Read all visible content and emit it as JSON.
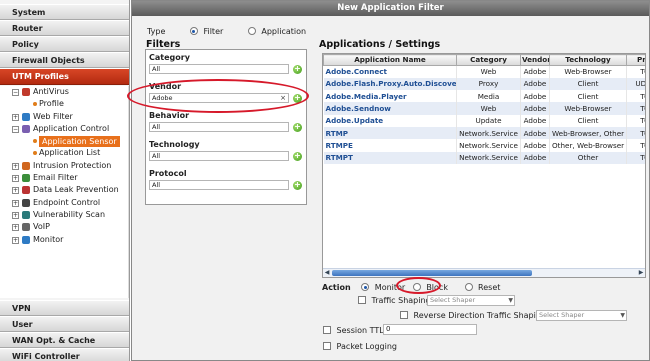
{
  "nav": {
    "top_sections": [
      "System",
      "Router",
      "Policy",
      "Firewall Objects",
      "UTM Profiles"
    ],
    "active_section": "UTM Profiles",
    "tree": [
      {
        "label": "AntiVirus",
        "level": 0,
        "expander": "−",
        "icon_color": "#c0392b",
        "icon": "shield-icon"
      },
      {
        "label": "Profile",
        "level": 1,
        "icon": "bullet-icon"
      },
      {
        "label": "Web Filter",
        "level": 0,
        "expander": "+",
        "icon_color": "#2e7bc4",
        "icon": "globe-icon"
      },
      {
        "label": "Application Control",
        "level": 0,
        "expander": "−",
        "icon_color": "#7a5fb0",
        "icon": "app-control-icon"
      },
      {
        "label": "Application Sensor",
        "level": 1,
        "selected": true,
        "icon": "bullet-icon"
      },
      {
        "label": "Application List",
        "level": 1,
        "icon": "bullet-icon"
      },
      {
        "label": "Intrusion Protection",
        "level": 0,
        "expander": "+",
        "icon_color": "#d0661e",
        "icon": "shield-icon"
      },
      {
        "label": "Email Filter",
        "level": 0,
        "expander": "+",
        "icon_color": "#3b8e3b",
        "icon": "mail-icon"
      },
      {
        "label": "Data Leak Prevention",
        "level": 0,
        "expander": "+",
        "icon_color": "#b33",
        "icon": "lock-icon"
      },
      {
        "label": "Endpoint Control",
        "level": 0,
        "expander": "+",
        "icon_color": "#444",
        "icon": "computer-icon"
      },
      {
        "label": "Vulnerability Scan",
        "level": 0,
        "expander": "+",
        "icon_color": "#2a7a7a",
        "icon": "scan-icon"
      },
      {
        "label": "VoIP",
        "level": 0,
        "expander": "+",
        "icon_color": "#666",
        "icon": "phone-icon"
      },
      {
        "label": "Monitor",
        "level": 0,
        "expander": "+",
        "icon_color": "#2e7bc4",
        "icon": "monitor-icon"
      }
    ],
    "bottom_sections": [
      "VPN",
      "User",
      "WAN Opt. & Cache",
      "WiFi Controller"
    ]
  },
  "dialog": {
    "title": "New Application Filter",
    "type_label": "Type",
    "type_options": [
      "Filter",
      "Application"
    ],
    "type_selected": "Filter",
    "filters_title": "Filters",
    "filters": [
      {
        "label": "Category",
        "value": "All"
      },
      {
        "label": "Vendor",
        "value": "Adobe",
        "clear": "×"
      },
      {
        "label": "Behavior",
        "value": "All"
      },
      {
        "label": "Technology",
        "value": "All"
      },
      {
        "label": "Protocol",
        "value": "All"
      }
    ],
    "add_glyph": "+",
    "apps_title": "Applications / Settings",
    "columns": [
      "Application Name",
      "Category",
      "Vendor",
      "Technology",
      "Proto"
    ],
    "rows": [
      [
        "Adobe.Connect",
        "Web",
        "Adobe",
        "Web-Browser",
        "TCP,"
      ],
      [
        "Adobe.Flash.Proxy.Auto.Discovery",
        "Proxy",
        "Adobe",
        "Client",
        "UDP, D"
      ],
      [
        "Adobe.Media.Player",
        "Media",
        "Adobe",
        "Client",
        "TCP,"
      ],
      [
        "Adobe.Sendnow",
        "Web",
        "Adobe",
        "Web-Browser",
        "TCP,"
      ],
      [
        "Adobe.Update",
        "Update",
        "Adobe",
        "Client",
        "TCP,"
      ],
      [
        "RTMP",
        "Network.Service",
        "Adobe",
        "Web-Browser, Other",
        "TCP,"
      ],
      [
        "RTMPE",
        "Network.Service",
        "Adobe",
        "Other, Web-Browser",
        "TCP,"
      ],
      [
        "RTMPT",
        "Network.Service",
        "Adobe",
        "Other",
        "TCP,"
      ]
    ],
    "action": {
      "label": "Action",
      "options": [
        "Monitor",
        "Block",
        "Reset"
      ],
      "selected": "Monitor",
      "traffic_shaping_label": "Traffic Shaping",
      "shaper_placeholder": "Select Shaper",
      "reverse_shaping_label": "Reverse Direction Traffic Shaping",
      "reverse_shaper_placeholder": "Select Shaper",
      "session_ttl_label": "Session TTL",
      "session_ttl_value": "0",
      "packet_logging_label": "Packet Logging"
    }
  },
  "colors": {
    "active_nav": "#c43516",
    "selected_item": "#e8701b",
    "link_blue": "#1f4f94",
    "annotation": "#d6192a"
  }
}
